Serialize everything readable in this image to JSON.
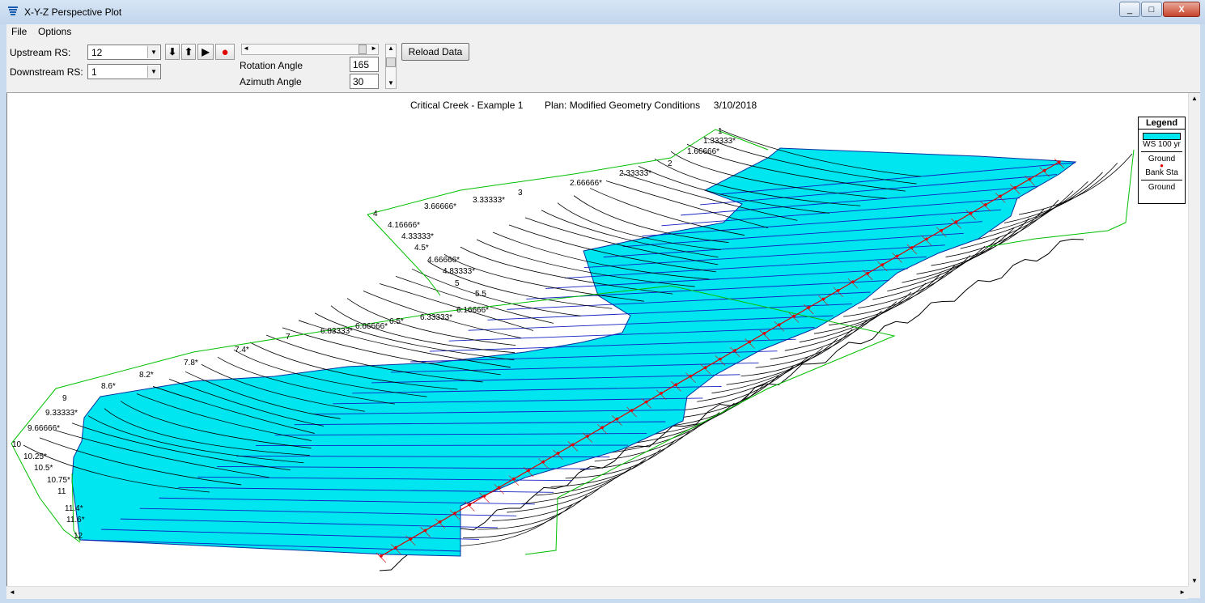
{
  "window": {
    "title": "X-Y-Z Perspective Plot",
    "min_label": "_",
    "max_label": "□",
    "close_label": "X"
  },
  "menu": [
    "File",
    "Options"
  ],
  "controls": {
    "upstream_label": "Upstream RS:",
    "upstream_value": "12",
    "downstream_label": "Downstream RS:",
    "downstream_value": "1",
    "rotation_label": "Rotation Angle",
    "rotation_value": "165",
    "azimuth_label": "Azimuth Angle",
    "azimuth_value": "30",
    "reload_label": "Reload Data"
  },
  "plot": {
    "title": "Critical Creek - Example 1        Plan: Modified Geometry Conditions     3/10/2018",
    "colors": {
      "water": "#00e6f0",
      "ground": "#000000",
      "bank": "#e00000",
      "edge": "#00c000"
    }
  },
  "legend": {
    "title": "Legend",
    "items": [
      {
        "name": "WS 100 yr",
        "type": "water-fill"
      },
      {
        "name": "Ground",
        "type": "line"
      },
      {
        "name": "Bank Sta",
        "type": "point"
      },
      {
        "name": "Ground",
        "type": "line"
      }
    ]
  },
  "river_stations": [
    "1",
    "1.33333*",
    "1.66666*",
    "2",
    "2.33333*",
    "2.66666*",
    "3",
    "3.33333*",
    "3.66666*",
    "4",
    "4.16666*",
    "4.33333*",
    "4.5*",
    "4.66666*",
    "4.83333*",
    "5",
    "5.5",
    "6.16666*",
    "6.33333*",
    "6.5*",
    "6.66666*",
    "6.83333*",
    "7",
    "7.4*",
    "7.8*",
    "8.2*",
    "8.6*",
    "9",
    "9.33333*",
    "9.66666*",
    "10",
    "10.25*",
    "10.5*",
    "10.75*",
    "11",
    "11.4*",
    "11.6*",
    "12"
  ]
}
